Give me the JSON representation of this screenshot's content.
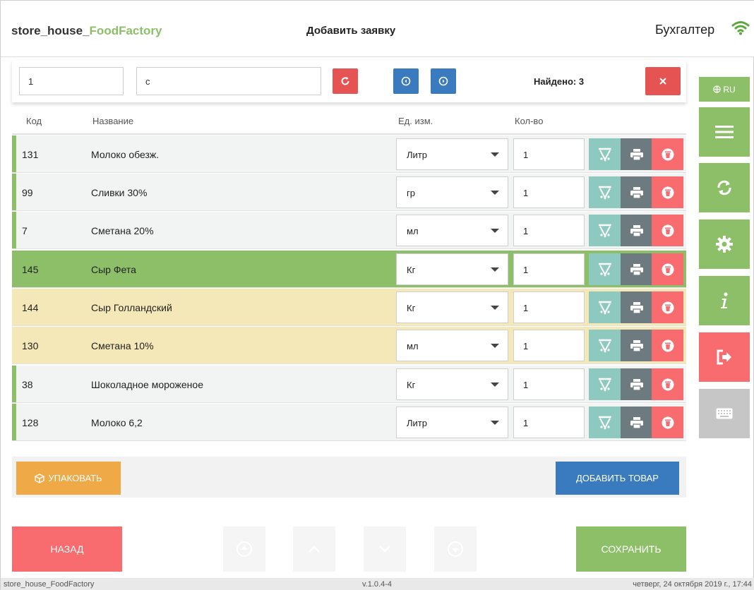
{
  "header": {
    "brand_prefix": "store_house_",
    "brand_suffix": "FoodFactory",
    "title": "Добавить заявку",
    "user_role": "Бухгалтер"
  },
  "search": {
    "code_value": "1",
    "name_value": "c",
    "found_text": "Найдено: 3"
  },
  "table": {
    "columns": {
      "code": "Код",
      "name": "Название",
      "unit": "Ед. изм.",
      "qty": "Кол-во"
    },
    "rows": [
      {
        "code": "131",
        "name": "Молоко обезж.",
        "unit": "Литр",
        "qty": "1"
      },
      {
        "code": "99",
        "name": "Сливки 30%",
        "unit": "гр",
        "qty": "1"
      },
      {
        "code": "7",
        "name": "Сметана 20%",
        "unit": "мл",
        "qty": "1"
      },
      {
        "code": "145",
        "name": "Сыр Фета",
        "unit": "Кг",
        "qty": "1"
      },
      {
        "code": "144",
        "name": "Сыр Голландский",
        "unit": "Кг",
        "qty": "1"
      },
      {
        "code": "130",
        "name": "Сметана 10%",
        "unit": "мл",
        "qty": "1"
      },
      {
        "code": "38",
        "name": "Шоколадное мороженое",
        "unit": "Кг",
        "qty": "1"
      },
      {
        "code": "128",
        "name": "Молоко 6,2",
        "unit": "Литр",
        "qty": "1"
      }
    ]
  },
  "actions": {
    "pack_label": "УПАКОВАТЬ",
    "add_label": "ДОБАВИТЬ ТОВАР"
  },
  "footer": {
    "back_label": "НАЗАД",
    "save_label": "СОХРАНИТЬ"
  },
  "status": {
    "app_name": "store_house_FoodFactory",
    "version": "v.1.0.4-4",
    "datetime": "четверг, 24 октября 2019 г., 17:44"
  },
  "side": {
    "lang": "RU"
  },
  "colors": {
    "green": "#8cbf68",
    "red": "#f86b6e",
    "blue": "#3a7bbf",
    "teal": "#8ec9c0",
    "gray": "#6d7b80",
    "orange": "#f0a947",
    "yellow_row": "#f4e8b8"
  }
}
